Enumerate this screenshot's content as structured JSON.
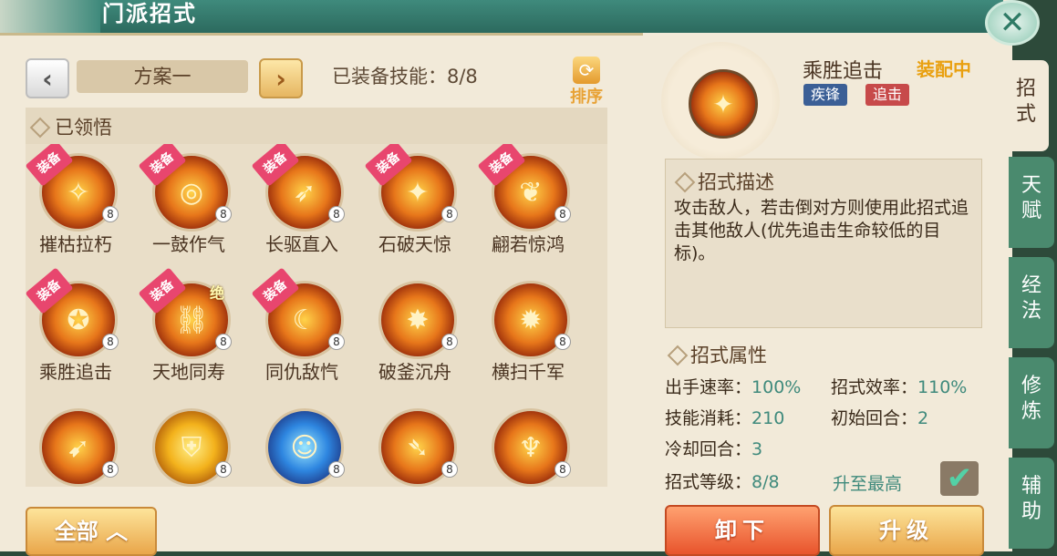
{
  "window": {
    "title": "门派招式",
    "close_icon": "close-icon"
  },
  "plan": {
    "name": "方案一",
    "equipped_label": "已装备技能：8/8",
    "sort_label": "排序"
  },
  "section": {
    "title": "已领悟"
  },
  "ribbon_label": "装备",
  "skills": [
    {
      "name": "摧枯拉朽",
      "level": "8",
      "equipped": true,
      "jue": ""
    },
    {
      "name": "一鼓作气",
      "level": "8",
      "equipped": true,
      "jue": ""
    },
    {
      "name": "长驱直入",
      "level": "8",
      "equipped": true,
      "jue": ""
    },
    {
      "name": "石破天惊",
      "level": "8",
      "equipped": true,
      "jue": ""
    },
    {
      "name": "翩若惊鸿",
      "level": "8",
      "equipped": true,
      "jue": ""
    },
    {
      "name": "乘胜追击",
      "level": "8",
      "equipped": true,
      "jue": ""
    },
    {
      "name": "天地同寿",
      "level": "8",
      "equipped": true,
      "jue": "绝"
    },
    {
      "name": "同仇敌忾",
      "level": "8",
      "equipped": true,
      "jue": ""
    },
    {
      "name": "破釜沉舟",
      "level": "8",
      "equipped": false,
      "jue": ""
    },
    {
      "name": "横扫千军",
      "level": "8",
      "equipped": false,
      "jue": ""
    },
    {
      "name": "",
      "level": "8",
      "equipped": false,
      "jue": ""
    },
    {
      "name": "",
      "level": "8",
      "equipped": false,
      "jue": ""
    },
    {
      "name": "",
      "level": "8",
      "equipped": false,
      "jue": ""
    },
    {
      "name": "",
      "level": "8",
      "equipped": false,
      "jue": ""
    },
    {
      "name": "",
      "level": "8",
      "equipped": false,
      "jue": ""
    }
  ],
  "filter": {
    "label": "全部"
  },
  "detail": {
    "name": "乘胜追击",
    "status": "装配中",
    "tags": [
      "疾锋",
      "追击"
    ],
    "desc_title": "招式描述",
    "desc": "攻击敌人，若击倒对方则使用此招式追击其他敌人(优先追击生命较低的目标)。",
    "attr_title": "招式属性",
    "attrs": {
      "speed_label": "出手速率：",
      "speed": "100%",
      "eff_label": "招式效率：",
      "eff": "110%",
      "cost_label": "技能消耗：",
      "cost": "210",
      "start_label": "初始回合：",
      "start": "2",
      "cd_label": "冷却回合：",
      "cd": "3",
      "level_label": "招式等级：",
      "level": "8/8"
    },
    "max_label": "升至最高",
    "unequip": "卸下",
    "upgrade": "升级"
  },
  "tabs": [
    "招式",
    "天赋",
    "经法",
    "修炼",
    "辅助"
  ]
}
